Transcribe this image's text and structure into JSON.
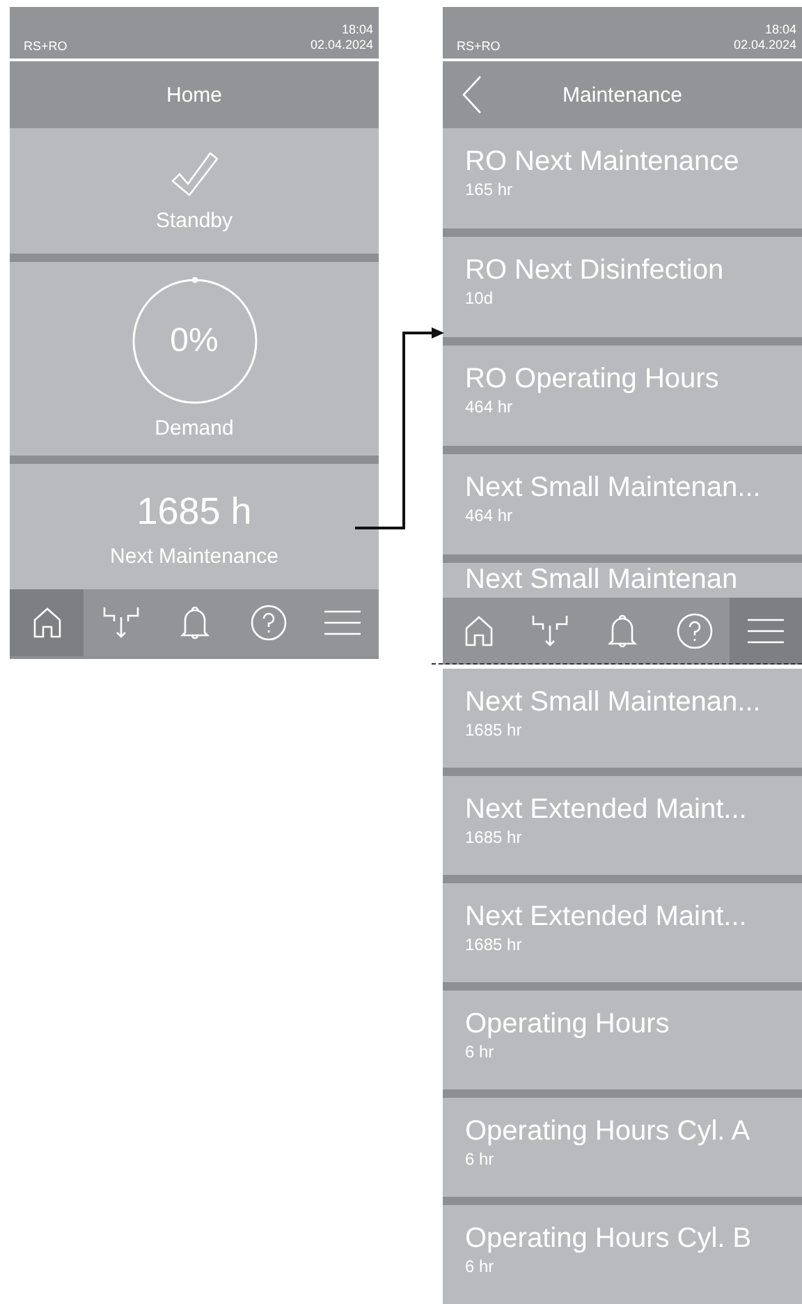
{
  "home_screen": {
    "status_bar": {
      "device": "RS+RO",
      "time": "18:04",
      "date": "02.04.2024"
    },
    "header": {
      "title": "Home"
    },
    "tiles": [
      {
        "kind": "status",
        "label": "Standby"
      },
      {
        "kind": "gauge",
        "value": "0%",
        "level": 0,
        "label": "Demand"
      },
      {
        "kind": "value",
        "value": "1685 h",
        "label": "Next Maintenance"
      }
    ],
    "nav": [
      {
        "kind": "home",
        "selected": true
      },
      {
        "kind": "tap",
        "selected": false
      },
      {
        "kind": "bell",
        "selected": false
      },
      {
        "kind": "help",
        "selected": false
      },
      {
        "kind": "menu",
        "selected": false
      }
    ]
  },
  "maintenance_screen": {
    "status_bar": {
      "device": "RS+RO",
      "time": "18:04",
      "date": "02.04.2024"
    },
    "header": {
      "title": "Maintenance",
      "back": true
    },
    "items": [
      {
        "label": "RO Next Maintenance",
        "value": "165 hr"
      },
      {
        "label": "RO Next Disinfection",
        "value": "10d"
      },
      {
        "label": "RO Operating Hours",
        "value": "464 hr"
      },
      {
        "label": "Next Small Maintenan...",
        "value": "464 hr"
      },
      {
        "label": "Next Small Maintenan"
      }
    ],
    "nav": [
      {
        "kind": "home",
        "selected": false
      },
      {
        "kind": "tap",
        "selected": false
      },
      {
        "kind": "bell",
        "selected": false
      },
      {
        "kind": "help",
        "selected": false
      },
      {
        "kind": "menu",
        "selected": true
      }
    ]
  },
  "continuation": {
    "items": [
      {
        "label": "Next Small Maintenan...",
        "value": "1685 hr"
      },
      {
        "label": "Next Extended Maint...",
        "value": "1685 hr"
      },
      {
        "label": "Next Extended Maint...",
        "value": "1685 hr"
      },
      {
        "label": "Operating Hours",
        "value": "6 hr"
      },
      {
        "label": "Operating Hours Cyl. A",
        "value": "6 hr"
      },
      {
        "label": "Operating Hours Cyl. B",
        "value": "6 hr"
      }
    ]
  }
}
